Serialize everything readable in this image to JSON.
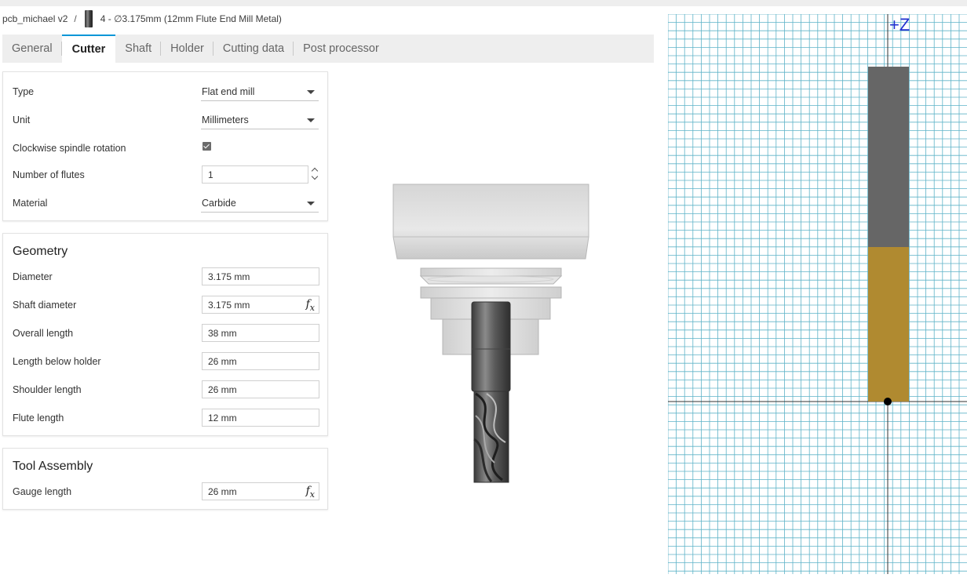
{
  "breadcrumb": {
    "project": "pcb_michael v2",
    "separator": "/",
    "tool_icon": "end-mill-icon",
    "tool_name": "4 - ∅3.175mm (12mm Flute End Mill Metal)"
  },
  "tabs": [
    {
      "label": "General"
    },
    {
      "label": "Cutter"
    },
    {
      "label": "Shaft"
    },
    {
      "label": "Holder"
    },
    {
      "label": "Cutting data"
    },
    {
      "label": "Post processor"
    }
  ],
  "active_tab": "Cutter",
  "cutter": {
    "type_label": "Type",
    "type_value": "Flat end mill",
    "unit_label": "Unit",
    "unit_value": "Millimeters",
    "cw_label": "Clockwise spindle rotation",
    "cw_checked": true,
    "flutes_label": "Number of flutes",
    "flutes_value": "1",
    "material_label": "Material",
    "material_value": "Carbide"
  },
  "geometry": {
    "title": "Geometry",
    "diameter_label": "Diameter",
    "diameter_value": "3.175 mm",
    "shaft_label": "Shaft diameter",
    "shaft_value": "3.175 mm",
    "overall_label": "Overall length",
    "overall_value": "38 mm",
    "below_label": "Length below holder",
    "below_value": "26 mm",
    "shoulder_label": "Shoulder length",
    "shoulder_value": "26 mm",
    "flute_label": "Flute length",
    "flute_value": "12 mm"
  },
  "assembly": {
    "title": "Tool Assembly",
    "gauge_label": "Gauge length",
    "gauge_value": "26 mm"
  },
  "fx_label": "f",
  "fx_sub": "x",
  "profile": {
    "axis_label": "+Z",
    "shaft_color": "#666666",
    "flute_color": "#b08a30",
    "grid_color": "#5fb3c8"
  }
}
